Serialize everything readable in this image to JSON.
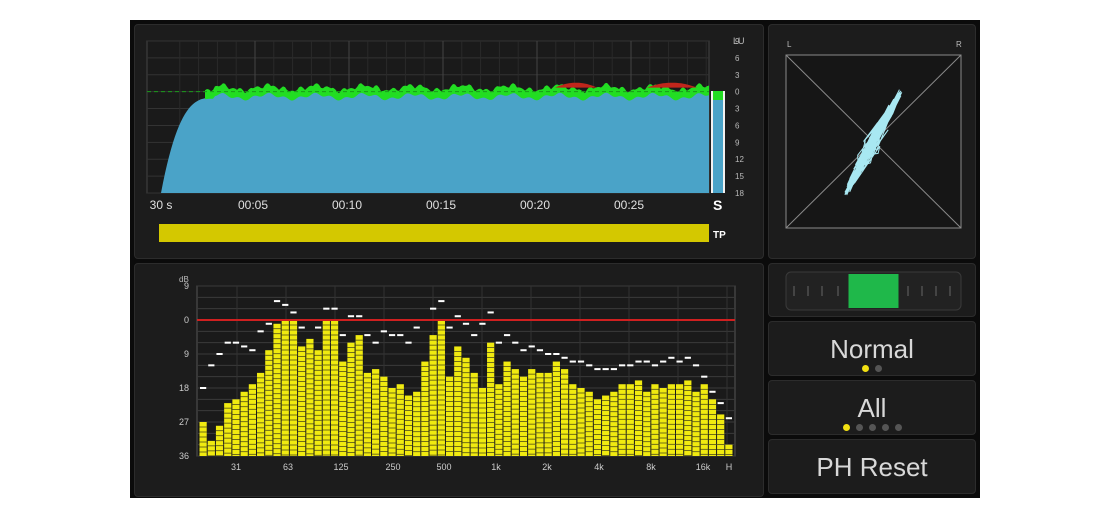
{
  "loudness": {
    "unit_label": "LU",
    "scale_labels": [
      "9",
      "6",
      "3",
      "0",
      "3",
      "6",
      "9",
      "12",
      "15",
      "18"
    ],
    "time_labels": [
      "30 s",
      "00:05",
      "00:10",
      "00:15",
      "00:20",
      "00:25"
    ],
    "short_term_label": "S",
    "true_peak_label": "TP",
    "colors": {
      "fill": "#4aa3c8",
      "level": "#22dd22",
      "over": "#c0261c",
      "true_peak_bar": "#d4c800"
    }
  },
  "vectorscope": {
    "left_label": "L",
    "right_label": "R"
  },
  "balance": {
    "value": 0.5,
    "colors": {
      "indicator": "#1fb84a"
    }
  },
  "mode_button": {
    "label": "Normal",
    "dot_count": 2,
    "active_dot": 0
  },
  "channel_button": {
    "label": "All",
    "dot_count": 5,
    "active_dot": 0
  },
  "reset_button": {
    "label": "PH Reset"
  },
  "chart_data": {
    "type": "bar",
    "ylabel": "dB",
    "y_tick_labels": [
      "9",
      "0",
      "9",
      "18",
      "27",
      "36"
    ],
    "x_tick_labels": [
      "31",
      "63",
      "125",
      "250",
      "500",
      "1k",
      "2k",
      "4k",
      "8k",
      "16k",
      "H"
    ],
    "ylim": [
      -36,
      9
    ],
    "reference_level": 0,
    "values": [
      -27,
      -32,
      -28,
      -22,
      -21,
      -19,
      -17,
      -14,
      -8,
      -1,
      0,
      0,
      -7,
      -5,
      -8,
      0,
      0,
      -11,
      -6,
      -4,
      -14,
      -13,
      -15,
      -18,
      -17,
      -20,
      -19,
      -11,
      -4,
      0,
      -15,
      -7,
      -10,
      -14,
      -18,
      -6,
      -17,
      -11,
      -13,
      -15,
      -13,
      -14,
      -14,
      -11,
      -13,
      -17,
      -18,
      -19,
      -21,
      -20,
      -19,
      -17,
      -17,
      -16,
      -19,
      -17,
      -18,
      -17,
      -17,
      -16,
      -19,
      -17,
      -21,
      -25,
      -33
    ],
    "peak_hold": [
      -18,
      -12,
      -9,
      -6,
      -6,
      -7,
      -8,
      -3,
      -1,
      5,
      4,
      2,
      -2,
      0,
      -2,
      3,
      3,
      -4,
      1,
      1,
      -4,
      -6,
      -3,
      -4,
      -4,
      -6,
      -2,
      0,
      3,
      5,
      -2,
      1,
      -1,
      -4,
      -1,
      2,
      -6,
      -4,
      -6,
      -8,
      -7,
      -8,
      -9,
      -9,
      -10,
      -11,
      -11,
      -12,
      -13,
      -13,
      -13,
      -12,
      -12,
      -11,
      -11,
      -12,
      -11,
      -10,
      -11,
      -10,
      -12,
      -15,
      -19,
      -22,
      -26
    ],
    "colors": {
      "bar": "#f0ea10",
      "over": "#e02020",
      "reference_line": "#d02020",
      "peak": "#ffffff"
    }
  }
}
